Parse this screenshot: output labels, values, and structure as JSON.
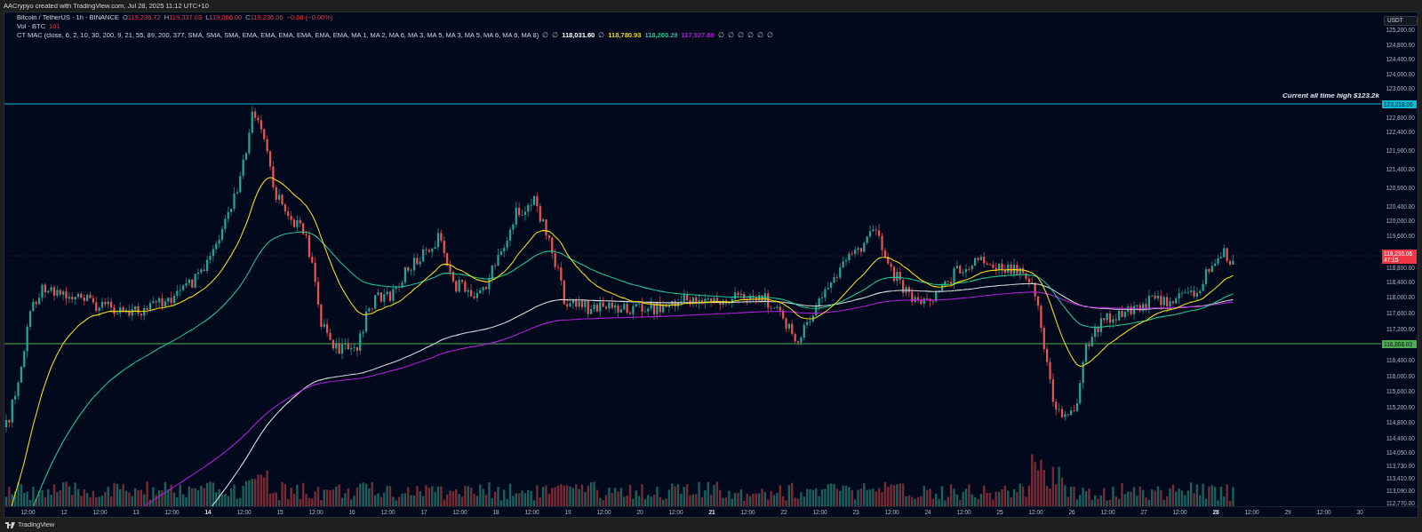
{
  "header": {
    "text": "AACrypyo created with TradingView.com, Jul 28, 2025 11:12 UTC+10"
  },
  "legend": {
    "symbol": "Bitcoin / TetherUS · 1h · BINANCE",
    "ohlc": [
      {
        "label": "O",
        "value": "119,236.72"
      },
      {
        "label": "H",
        "value": "119,337.03"
      },
      {
        "label": "L",
        "value": "119,066.00"
      },
      {
        "label": "C",
        "value": "119,236.06"
      }
    ],
    "change": "−0.66 (−0.00%)",
    "volume": {
      "label": "Vol · BTC",
      "value": "101"
    },
    "indicator": {
      "label": "CT MAC (close, 6, 2, 10, 30, 200, 9, 21, 55, 89, 200, 377, SMA, SMA, SMA, EMA, EMA, EMA, EMA, EMA, EMA, MA 1, MA 2, MA 6, MA 3, MA 5, MA 3, MA 5, MA 6, MA 6, MA 8)",
      "values": [
        {
          "kind": "empty",
          "text": "∅"
        },
        {
          "kind": "empty",
          "text": "∅"
        },
        {
          "kind": "value",
          "text": "118,031.60",
          "color": "#ffffff"
        },
        {
          "kind": "empty",
          "text": "∅"
        },
        {
          "kind": "value",
          "text": "118,780.93",
          "color": "#f5d90a"
        },
        {
          "kind": "value",
          "text": "118,260.29",
          "color": "#22c38e"
        },
        {
          "kind": "value",
          "text": "117,927.69",
          "color": "#b01fd6"
        },
        {
          "kind": "empty",
          "text": "∅"
        },
        {
          "kind": "empty",
          "text": "∅"
        },
        {
          "kind": "empty",
          "text": "∅"
        },
        {
          "kind": "empty",
          "text": "∅"
        },
        {
          "kind": "empty",
          "text": "∅"
        },
        {
          "kind": "empty",
          "text": "∅"
        }
      ]
    }
  },
  "annotation": "Current all time high $123.2k",
  "price_axis": {
    "currency": "USDT",
    "labels": [
      "125,200.00",
      "124,800.00",
      "124,400.00",
      "124,000.00",
      "123,600.00",
      "122,800.00",
      "122,400.00",
      "121,900.00",
      "121,400.00",
      "120,900.00",
      "120,400.00",
      "120,000.00",
      "119,600.00",
      "118,800.00",
      "118,400.00",
      "118,000.00",
      "117,600.00",
      "117,200.00",
      "116,400.00",
      "116,000.00",
      "115,600.00",
      "115,200.00",
      "114,800.00",
      "114,400.00",
      "114,050.00",
      "113,730.00",
      "113,410.00",
      "113,090.00",
      "112,770.00"
    ],
    "markers": [
      {
        "kind": "level",
        "text": "123,218.00",
        "color": "#00bcd4"
      },
      {
        "kind": "price",
        "text": "119,236.06",
        "countdown": "47:15",
        "color": "#f23645"
      },
      {
        "kind": "level",
        "text": "116,868.00",
        "color": "#4caf50"
      }
    ]
  },
  "time_axis": {
    "ticks": [
      {
        "label": "12:00",
        "bold": false
      },
      {
        "label": "12",
        "bold": false
      },
      {
        "label": "12:00",
        "bold": false
      },
      {
        "label": "13",
        "bold": false
      },
      {
        "label": "12:00",
        "bold": false
      },
      {
        "label": "14",
        "bold": true
      },
      {
        "label": "12:00",
        "bold": false
      },
      {
        "label": "15",
        "bold": false
      },
      {
        "label": "12:00",
        "bold": false
      },
      {
        "label": "16",
        "bold": false
      },
      {
        "label": "12:00",
        "bold": false
      },
      {
        "label": "17",
        "bold": false
      },
      {
        "label": "12:00",
        "bold": false
      },
      {
        "label": "18",
        "bold": false
      },
      {
        "label": "12:00",
        "bold": false
      },
      {
        "label": "19",
        "bold": false
      },
      {
        "label": "12:00",
        "bold": false
      },
      {
        "label": "20",
        "bold": false
      },
      {
        "label": "12:00",
        "bold": false
      },
      {
        "label": "21",
        "bold": true
      },
      {
        "label": "12:00",
        "bold": false
      },
      {
        "label": "22",
        "bold": false
      },
      {
        "label": "12:00",
        "bold": false
      },
      {
        "label": "23",
        "bold": false
      },
      {
        "label": "12:00",
        "bold": false
      },
      {
        "label": "24",
        "bold": false
      },
      {
        "label": "12:00",
        "bold": false
      },
      {
        "label": "25",
        "bold": false
      },
      {
        "label": "12:00",
        "bold": false
      },
      {
        "label": "26",
        "bold": false
      },
      {
        "label": "12:00",
        "bold": false
      },
      {
        "label": "27",
        "bold": false
      },
      {
        "label": "12:00",
        "bold": false
      },
      {
        "label": "28",
        "bold": true
      },
      {
        "label": "12:00",
        "bold": false
      },
      {
        "label": "29",
        "bold": false
      },
      {
        "label": "12:00",
        "bold": false
      },
      {
        "label": "30",
        "bold": false
      }
    ]
  },
  "footer": {
    "brand": "TradingView"
  }
}
